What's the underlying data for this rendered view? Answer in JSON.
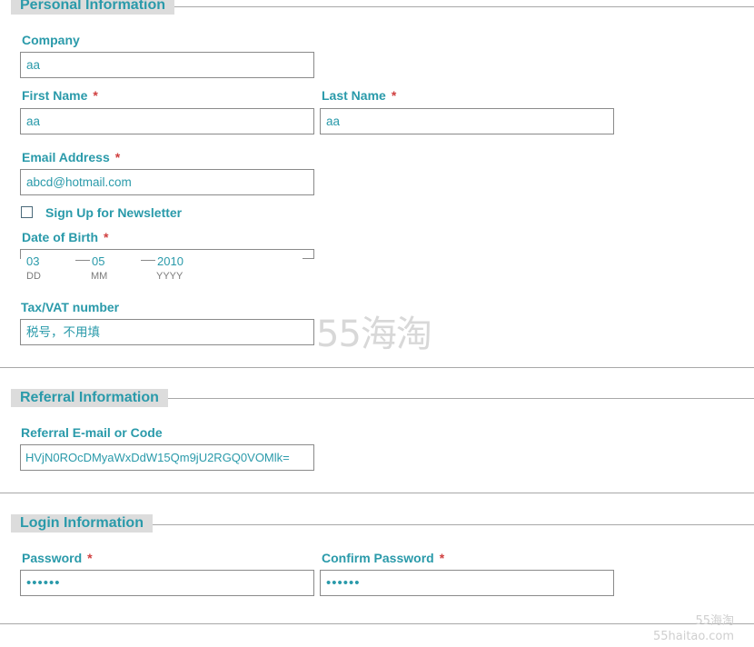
{
  "personal": {
    "legend": "Personal Information",
    "company_label": "Company",
    "company_value": "aa",
    "first_name_label": "First Name",
    "first_name_value": "aa",
    "last_name_label": "Last Name",
    "last_name_value": "aa",
    "email_label": "Email Address",
    "email_value": "abcd@hotmail.com",
    "newsletter_label": "Sign Up for Newsletter",
    "newsletter_checked": false,
    "dob_label": "Date of Birth",
    "dob_day": "03",
    "dob_month": "05",
    "dob_year": "2010",
    "dob_day_hint": "DD",
    "dob_month_hint": "MM",
    "dob_year_hint": "YYYY",
    "tax_label": "Tax/VAT number",
    "tax_value": "税号，不用填"
  },
  "referral": {
    "legend": "Referral Information",
    "code_label": "Referral E-mail or Code",
    "code_value": "HVjN0ROcDMyaWxDdW15Qm9jU2RGQ0VOMlk="
  },
  "login": {
    "legend": "Login Information",
    "password_label": "Password",
    "password_value": "••••••",
    "confirm_label": "Confirm Password",
    "confirm_value": "••••••"
  },
  "required_marker": "*",
  "watermark": {
    "main": "55海淘",
    "corner_top": "55海淘",
    "corner_bottom": "55haitao.com"
  },
  "colors": {
    "label": "#2a9aaa",
    "required": "#d04040",
    "legend_bg": "#dcdcdc",
    "border": "#8a8a8a"
  }
}
